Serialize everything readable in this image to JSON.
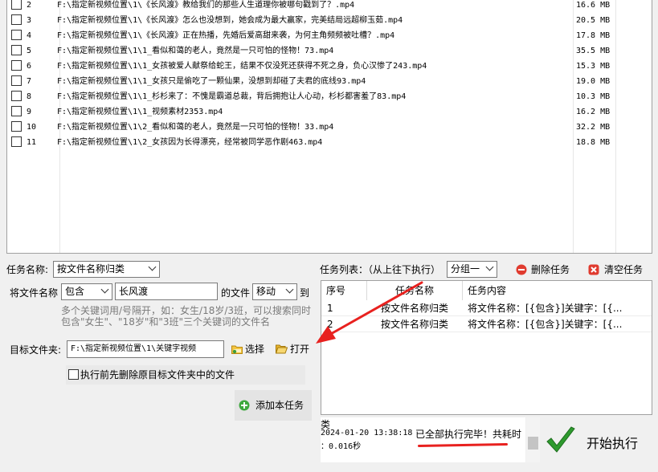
{
  "files": [
    {
      "checked": false,
      "num": "2",
      "path": "F:\\指定新视频位置\\1\\《长风渡》教给我们的那些人生道理你被哪句戳到了？.mp4",
      "size": "16.6 MB"
    },
    {
      "checked": false,
      "num": "3",
      "path": "F:\\指定新视频位置\\1\\《长风渡》怎么也没想到，她会成为最大赢家，完美结局远超柳玉茹.mp4",
      "size": "20.5 MB"
    },
    {
      "checked": false,
      "num": "4",
      "path": "F:\\指定新视频位置\\1\\《长风渡》正在热播，先婚后爱高甜来袭，为何主角频频被吐槽？.mp4",
      "size": "17.8 MB"
    },
    {
      "checked": false,
      "num": "5",
      "path": "F:\\指定新视频位置\\1\\1_看似和蔼的老人，竟然是一只可怕的怪物！73.mp4",
      "size": "35.5 MB"
    },
    {
      "checked": false,
      "num": "6",
      "path": "F:\\指定新视频位置\\1\\1_女孩被爱人献祭给蛇王，结果不仅没死还获得不死之身，负心汉惨了243.mp4",
      "size": "15.3 MB"
    },
    {
      "checked": false,
      "num": "7",
      "path": "F:\\指定新视频位置\\1\\1_女孩只是偷吃了一颗仙果，没想到却碰了夫君的底线93.mp4",
      "size": "19.0 MB"
    },
    {
      "checked": false,
      "num": "8",
      "path": "F:\\指定新视频位置\\1\\1_杉杉来了：不愧是霸道总裁，背后拥抱让人心动，杉杉都害羞了83.mp4",
      "size": "10.3 MB"
    },
    {
      "checked": false,
      "num": "9",
      "path": "F:\\指定新视频位置\\1\\1_视频素材2353.mp4",
      "size": "16.2 MB"
    },
    {
      "checked": false,
      "num": "10",
      "path": "F:\\指定新视频位置\\1\\2_看似和蔼的老人，竟然是一只可怕的怪物！33.mp4",
      "size": "32.2 MB"
    },
    {
      "checked": false,
      "num": "11",
      "path": "F:\\指定新视频位置\\1\\2_女孩因为长得漂亮，经常被同学恶作剧463.mp4",
      "size": "18.8 MB"
    }
  ],
  "task_form": {
    "task_name_label": "任务名称:",
    "task_name_value": "按文件名称归类",
    "rename_label": "将文件名称",
    "match_mode": "包含",
    "keyword": "长风渡",
    "of_file_label": "的文件",
    "action_mode": "移动",
    "to_label": "到",
    "hint_line1": "多个关键词用/号隔开，如：女生/18岁/3班，可以搜索同时",
    "hint_line2": "包含\"女生\"、\"18岁\"和\"3班\"三个关键词的文件名",
    "target_folder_label": "目标文件夹:",
    "target_folder_value": "F:\\指定新视频位置\\1\\关键字视频",
    "choose_label": "选择",
    "open_label": "打开",
    "delete_before_label": "执行前先删除原目标文件夹中的文件",
    "delete_before_checked": false,
    "add_task_label": "添加本任务"
  },
  "task_list": {
    "title": "任务列表：（从上往下执行）",
    "group_value": "分组一",
    "delete_task_label": "删除任务",
    "clear_tasks_label": "清空任务",
    "headers": [
      "序号",
      "任务名称",
      "任务内容"
    ],
    "rows": [
      {
        "num": "1",
        "name": "按文件名称归类",
        "content": "将文件名称：[{包含}]关键字：[{..."
      },
      {
        "num": "2",
        "name": "按文件名称归类",
        "content": "将文件名称：[{包含}]关键字：[{..."
      }
    ]
  },
  "log": {
    "line0": "类",
    "timestamp": "2024-01-20 13:38:18",
    "message": "已全部执行完毕！共耗时",
    "duration": "：0.016秒"
  },
  "start_label": "开始执行",
  "colors": {
    "annotation_red": "#e8211f",
    "check_green": "#2e9a2e",
    "delete_red": "#e03b2f"
  }
}
